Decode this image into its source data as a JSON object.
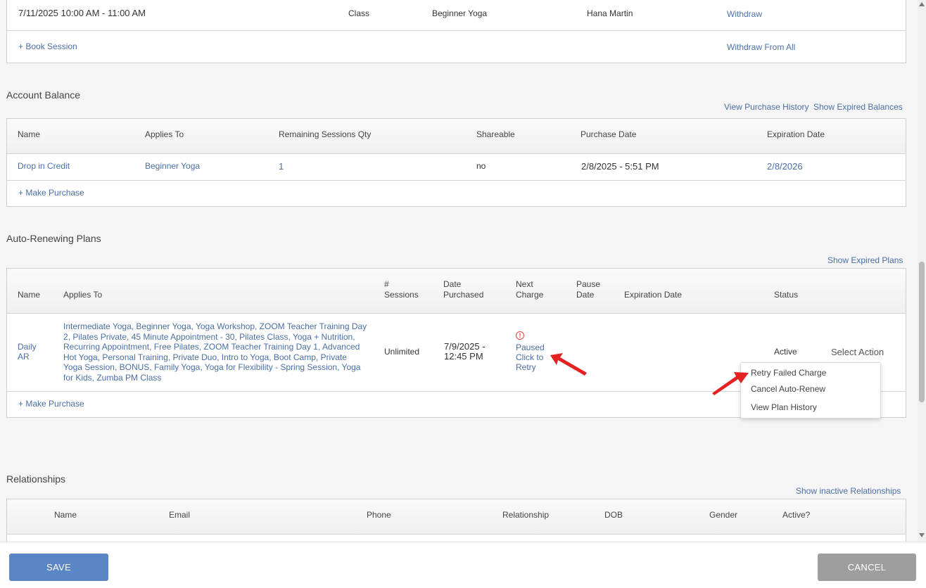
{
  "sessions": {
    "row": {
      "datetime": "7/11/2025 10:00 AM - 11:00 AM",
      "type": "Class",
      "name": "Beginner Yoga",
      "staff": "Hana Martin",
      "action": "Withdraw"
    },
    "book_link": "+ Book Session",
    "withdraw_all_link": "Withdraw From All"
  },
  "account_balance": {
    "title": "Account Balance",
    "view_history_link": "View Purchase History",
    "show_expired_link": "Show Expired Balances",
    "columns": [
      "Name",
      "Applies To",
      "Remaining Sessions Qty",
      "Shareable",
      "Purchase Date",
      "Expiration Date"
    ],
    "row": {
      "name": "Drop in Credit",
      "applies_to": "Beginner Yoga",
      "remaining": "1",
      "shareable": "no",
      "purchase_date": "2/8/2025 - 5:51 PM",
      "expiration_date": "2/8/2026"
    },
    "make_purchase_link": "+ Make Purchase"
  },
  "auto_renew": {
    "title": "Auto-Renewing Plans",
    "show_expired_link": "Show Expired Plans",
    "columns": {
      "name": "Name",
      "applies_to": "Applies To",
      "sessions": "# Sessions",
      "date_purchased": "Date Purchased",
      "next_charge": "Next Charge",
      "pause_date": "Pause Date",
      "expiration_date": "Expiration Date",
      "status": "Status"
    },
    "row": {
      "name": "Daily AR",
      "applies_to": "Intermediate Yoga, Beginner Yoga, Yoga Workshop, ZOOM Teacher Training Day 2, Pilates Private, 45 Minute Appointment - 30, Pilates Class, Yoga + Nutrition, Recurring Appointment, Free Pilates, ZOOM Teacher Training Day 1, Advanced Hot Yoga, Personal Training, Private Duo, Intro to Yoga, Boot Camp, Private Yoga Session, BONUS, Family Yoga, Yoga for Flexibility - Spring Session, Yoga for Kids, Zumba PM Class",
      "sessions": "Unlimited",
      "date_purchased": "7/9/2025 - 12:45 PM",
      "next_charge_status": "Paused Click to Retry",
      "status": "Active",
      "select_action": "Select Action"
    },
    "menu": {
      "items": [
        "Retry Failed Charge",
        "Cancel Auto-Renew",
        "View Plan History"
      ]
    },
    "make_purchase_link": "+ Make Purchase"
  },
  "relationships": {
    "title": "Relationships",
    "show_inactive_link": "Show inactive Relationships",
    "columns": [
      "Name",
      "Email",
      "Phone",
      "Relationship",
      "DOB",
      "Gender",
      "Active?"
    ]
  },
  "footer": {
    "save_label": "SAVE",
    "cancel_label": "CANCEL"
  },
  "colors": {
    "link": "#4a6fa5",
    "save_button": "#5b86c5",
    "cancel_button": "#9e9e9e",
    "alert": "#e04040",
    "annotation_arrow": "#e52222"
  },
  "icons": {
    "next_charge_alert": "exclamation-circle-icon"
  }
}
